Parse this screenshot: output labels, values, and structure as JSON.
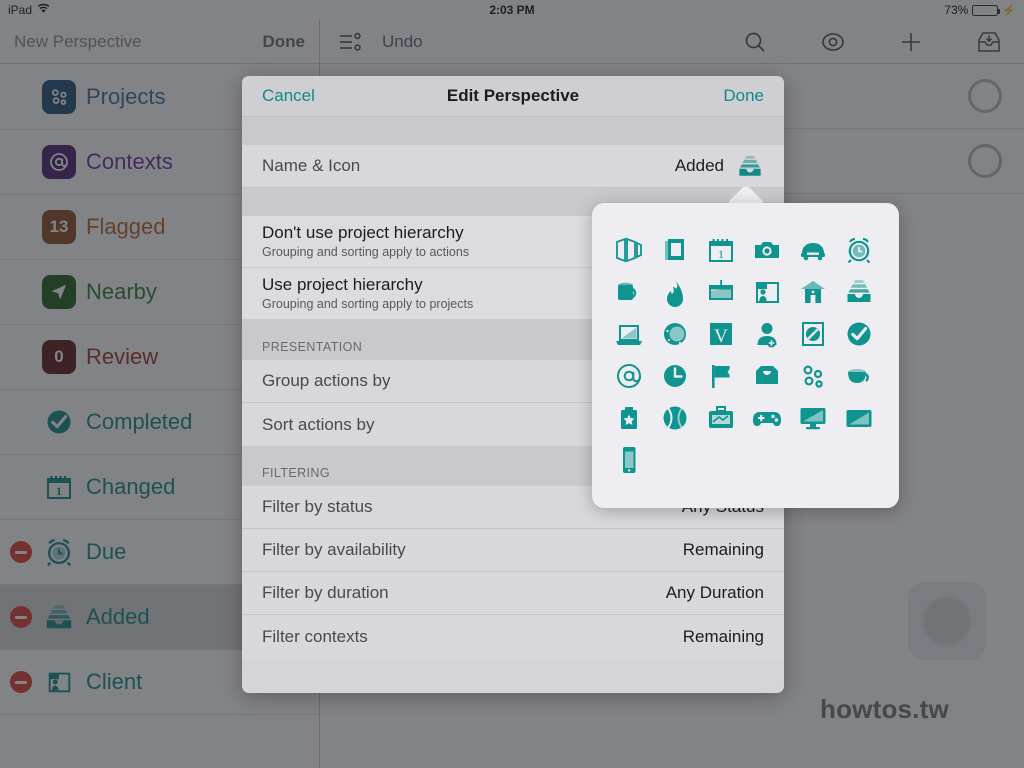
{
  "statusbar": {
    "device": "iPad",
    "wifi_icon": "wifi-icon",
    "time": "2:03 PM",
    "battery_percent": "73%",
    "battery_level": 73,
    "charging": true
  },
  "sidebar": {
    "header": {
      "title": "New Perspective",
      "done_label": "Done"
    },
    "items": [
      {
        "label": "Projects",
        "icon": "projects-icon",
        "icon_bg": "#1f4f7a",
        "text_color": "#3b6f9e",
        "starred": true,
        "deletable": false,
        "selected": false,
        "badge": ""
      },
      {
        "label": "Contexts",
        "icon": "at-icon",
        "icon_bg": "#4b1f6e",
        "text_color": "#6c2fa0",
        "starred": true,
        "deletable": false,
        "selected": false,
        "badge": ""
      },
      {
        "label": "Flagged",
        "icon": "flag-count-icon",
        "icon_bg": "#8a4a22",
        "text_color": "#b4642d",
        "starred": true,
        "deletable": false,
        "selected": false,
        "badge": "13"
      },
      {
        "label": "Nearby",
        "icon": "location-icon",
        "icon_bg": "#1f5c20",
        "text_color": "#2e7d32",
        "starred": false,
        "deletable": false,
        "selected": false,
        "badge": ""
      },
      {
        "label": "Review",
        "icon": "review-icon",
        "icon_bg": "#5c1b18",
        "text_color": "#9b3428",
        "starred": true,
        "deletable": false,
        "selected": false,
        "badge": "0"
      },
      {
        "label": "Completed",
        "icon": "check-circle-icon",
        "icon_bg": "",
        "text_color": "#0f8a85",
        "starred": false,
        "deletable": false,
        "selected": false,
        "badge": ""
      },
      {
        "label": "Changed",
        "icon": "calendar-icon",
        "icon_bg": "",
        "text_color": "#0f8a85",
        "starred": false,
        "deletable": false,
        "selected": false,
        "badge": ""
      },
      {
        "label": "Due",
        "icon": "alarm-clock-icon",
        "icon_bg": "",
        "text_color": "#0f8a85",
        "starred": true,
        "deletable": true,
        "selected": false,
        "badge": ""
      },
      {
        "label": "Added",
        "icon": "inbox-tray-icon",
        "icon_bg": "",
        "text_color": "#0f8a85",
        "starred": true,
        "deletable": true,
        "selected": true,
        "badge": ""
      },
      {
        "label": "Client",
        "icon": "client-folder-icon",
        "icon_bg": "",
        "text_color": "#0f8a85",
        "starred": true,
        "deletable": true,
        "selected": false,
        "badge": ""
      }
    ]
  },
  "main": {
    "toolbar": {
      "menu_icon": "list-menu-icon",
      "undo_label": "Undo",
      "search_icon": "search-icon",
      "eye_icon": "eye-icon",
      "add_icon": "plus-icon",
      "inbox_icon": "inbox-add-icon"
    }
  },
  "watermark": "howtos.tw",
  "modal": {
    "nav": {
      "cancel_label": "Cancel",
      "title": "Edit Perspective",
      "done_label": "Done"
    },
    "name_icon_row": {
      "label": "Name & Icon",
      "value": "Added",
      "icon": "inbox-tray-icon"
    },
    "hierarchy_options": [
      {
        "title": "Don't use project hierarchy",
        "subtitle": "Grouping and sorting apply to actions"
      },
      {
        "title": "Use project hierarchy",
        "subtitle": "Grouping and sorting apply to projects"
      }
    ],
    "presentation": {
      "header": "PRESENTATION",
      "rows": [
        {
          "label": "Group actions by",
          "value": ""
        },
        {
          "label": "Sort actions by",
          "value": ""
        }
      ]
    },
    "filtering": {
      "header": "FILTERING",
      "rows": [
        {
          "label": "Filter by status",
          "value": "Any Status"
        },
        {
          "label": "Filter by availability",
          "value": "Remaining"
        },
        {
          "label": "Filter by duration",
          "value": "Any Duration"
        },
        {
          "label": "Filter contexts",
          "value": "Remaining"
        }
      ]
    }
  },
  "icon_popover": {
    "accent_color": "#0f9490",
    "icons": [
      "panels-icon",
      "books-icon",
      "calendar-icon",
      "camera-icon",
      "car-icon",
      "alarm-clock-icon",
      "mug-icon",
      "fire-icon",
      "chalkboard-icon",
      "client-folder-icon",
      "house-icon",
      "inbox-tray-icon",
      "laptop-icon",
      "moon-icon",
      "letter-v-icon",
      "add-person-icon",
      "no-entry-sign-icon",
      "check-circle-icon",
      "at-icon",
      "clock-icon",
      "flag-icon",
      "inbox-icon",
      "projects-icon",
      "coffee-cup-icon",
      "star-bag-icon",
      "ball-icon",
      "briefcase-icon",
      "gamepad-icon",
      "monitor-icon",
      "tablet-icon",
      "phone-icon"
    ]
  }
}
